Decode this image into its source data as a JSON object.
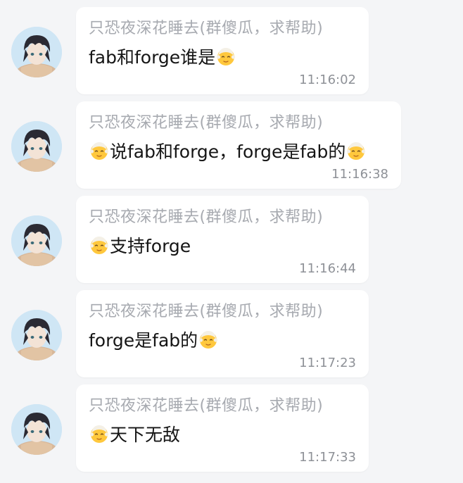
{
  "messages": [
    {
      "sender": "只恐夜深花睡去(群傻瓜，求帮助)",
      "segments": [
        {
          "type": "text",
          "value": "fab和forge谁是"
        },
        {
          "type": "emoji",
          "icon": "older-person-emoji"
        }
      ],
      "time": "11:16:02"
    },
    {
      "sender": "只恐夜深花睡去(群傻瓜，求帮助)",
      "segments": [
        {
          "type": "emoji",
          "icon": "older-person-emoji"
        },
        {
          "type": "text",
          "value": "说fab和forge，forge是fab的"
        },
        {
          "type": "emoji",
          "icon": "older-person-emoji"
        }
      ],
      "time": "11:16:38"
    },
    {
      "sender": "只恐夜深花睡去(群傻瓜，求帮助)",
      "segments": [
        {
          "type": "emoji",
          "icon": "older-person-emoji"
        },
        {
          "type": "text",
          "value": "支持forge"
        }
      ],
      "time": "11:16:44"
    },
    {
      "sender": "只恐夜深花睡去(群傻瓜，求帮助)",
      "segments": [
        {
          "type": "text",
          "value": "forge是fab的"
        },
        {
          "type": "emoji",
          "icon": "older-person-emoji"
        }
      ],
      "time": "11:17:23"
    },
    {
      "sender": "只恐夜深花睡去(群傻瓜，求帮助)",
      "segments": [
        {
          "type": "emoji",
          "icon": "older-person-emoji"
        },
        {
          "type": "text",
          "value": "天下无敌"
        }
      ],
      "time": "11:17:33"
    }
  ],
  "avatar_icon": "anime-avatar",
  "colors": {
    "background": "#f4f5f7",
    "bubble": "#ffffff",
    "sender_text": "#a7aab0",
    "message_text": "#151515",
    "time_text": "#8e9197"
  }
}
